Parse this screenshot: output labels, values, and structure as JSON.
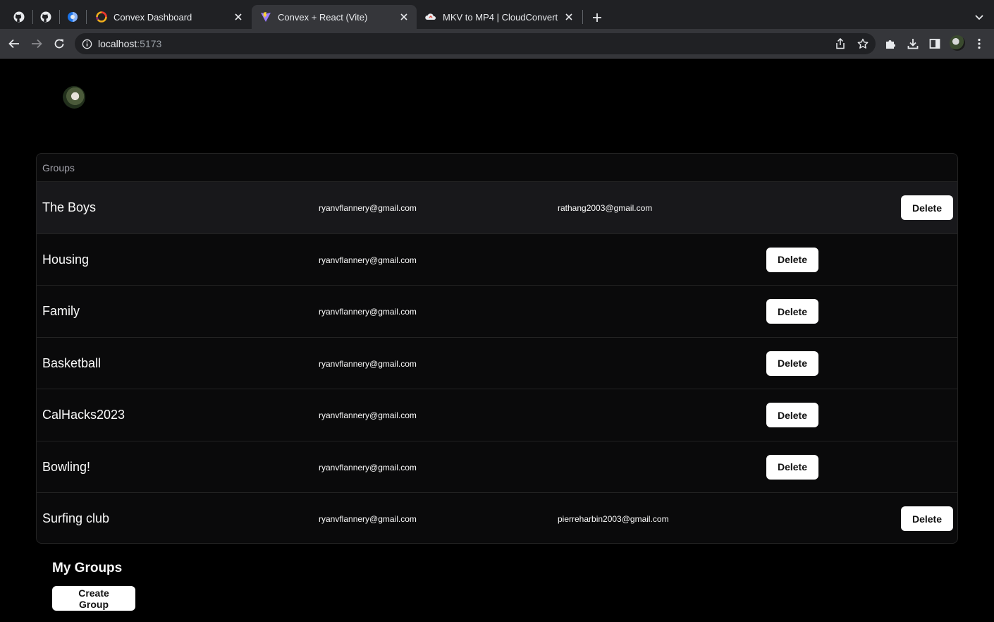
{
  "browser": {
    "tabs": [
      {
        "title": "Convex Dashboard"
      },
      {
        "title": "Convex + React (Vite)"
      },
      {
        "title": "MKV to MP4 | CloudConvert"
      }
    ],
    "url_host": "localhost",
    "url_port": ":5173"
  },
  "groups": {
    "heading": "Groups",
    "rows": [
      {
        "name": "The Boys",
        "email1": "ryanvflannery@gmail.com",
        "email2": "rathang2003@gmail.com",
        "delete_label": "Delete"
      },
      {
        "name": "Housing",
        "email1": "ryanvflannery@gmail.com",
        "email2": "",
        "delete_label": "Delete"
      },
      {
        "name": "Family",
        "email1": "ryanvflannery@gmail.com",
        "email2": "",
        "delete_label": "Delete"
      },
      {
        "name": "Basketball",
        "email1": "ryanvflannery@gmail.com",
        "email2": "",
        "delete_label": "Delete"
      },
      {
        "name": "CalHacks2023",
        "email1": "ryanvflannery@gmail.com",
        "email2": "",
        "delete_label": "Delete"
      },
      {
        "name": "Bowling!",
        "email1": "ryanvflannery@gmail.com",
        "email2": "",
        "delete_label": "Delete"
      },
      {
        "name": "Surfing club",
        "email1": "ryanvflannery@gmail.com",
        "email2": "pierreharbin2003@gmail.com",
        "delete_label": "Delete"
      }
    ]
  },
  "my_groups": {
    "title": "My Groups",
    "create_label": "Create Group"
  },
  "colors": {
    "page_bg": "#000000",
    "card_bg": "#0a0a0b",
    "highlight_row": "#18181b",
    "button_bg": "#ffffff"
  }
}
